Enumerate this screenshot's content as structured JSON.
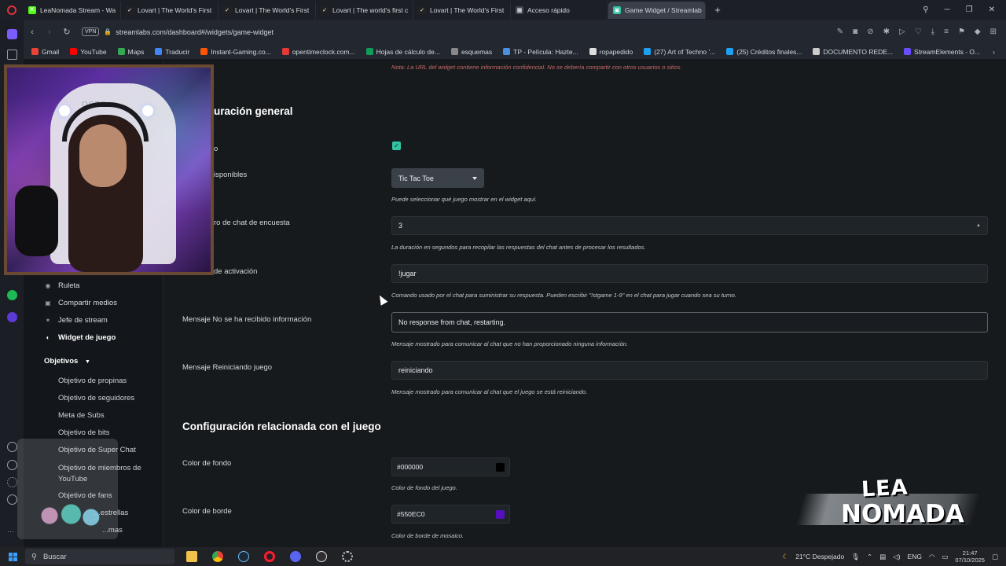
{
  "browser": {
    "tabs": [
      {
        "label": "LeaNomada Stream - Wa",
        "color": "#53fc18",
        "glyph": "K"
      },
      {
        "label": "Lovart | The World's First",
        "color": "#222222",
        "glyph": "✓"
      },
      {
        "label": "Lovart | The World's First",
        "color": "#222222",
        "glyph": "✓"
      },
      {
        "label": "Lovart | The world's first c",
        "color": "#222222",
        "glyph": "✓"
      },
      {
        "label": "Lovart | The World's First",
        "color": "#222222",
        "glyph": "✓"
      },
      {
        "label": "Acceso rápido",
        "color": "#444b55",
        "glyph": "▦"
      },
      {
        "label": "Game Widget / Streamlab",
        "color": "#31c3a2",
        "glyph": "▣"
      }
    ],
    "url": "streamlabs.com/dashboard#/widgets/game-widget",
    "vpn_label": "VPN",
    "bookmarks": [
      {
        "label": "Gmail",
        "color": "#ea4335"
      },
      {
        "label": "YouTube",
        "color": "#ff0000"
      },
      {
        "label": "Maps",
        "color": "#34a853"
      },
      {
        "label": "Traducir",
        "color": "#4285f4"
      },
      {
        "label": "Instant-Gaming.co...",
        "color": "#ff5400"
      },
      {
        "label": "opentimeclock.com...",
        "color": "#e53935"
      },
      {
        "label": "Hojas de cálculo de...",
        "color": "#0f9d58"
      },
      {
        "label": "esquemas",
        "color": "#888888"
      },
      {
        "label": "TP - Película: Hazte...",
        "color": "#4a90e2"
      },
      {
        "label": "ropapedido",
        "color": "#dddddd"
      },
      {
        "label": "(27) Art of Techno '...",
        "color": "#1da1f2"
      },
      {
        "label": "(25) Créditos finales...",
        "color": "#1da1f2"
      },
      {
        "label": "DOCUMENTO REDE...",
        "color": "#cccccc"
      },
      {
        "label": "StreamElements - O...",
        "color": "#6a4cff"
      }
    ]
  },
  "sidebar": {
    "items": [
      {
        "label": "Ruleta"
      },
      {
        "label": "Compartir medios"
      },
      {
        "label": "Jefe de stream"
      },
      {
        "label": "Widget de juego"
      }
    ],
    "goals_header": "Objetivos",
    "goals": [
      "Objetivo de propinas",
      "Objetivo de seguidores",
      "Meta de Subs",
      "Objetivo de bits",
      "Objetivo de Super Chat",
      "Objetivo de miembros de YouTube",
      "Objetivo de fans",
      "...estrellas",
      "...mas"
    ]
  },
  "main": {
    "note": "Nota: La URL del widget contiene información confidencial. No se debería compartir con otros usuarios o sitios.",
    "general_title": "uración general",
    "enabled_label": "o",
    "games_label": "isponibles",
    "game_select_value": "Tic Tac Toe",
    "game_help": "Puede seleccionar qué juego mostrar en el widget aquí.",
    "timer_label": "ro de chat de encuesta",
    "timer_value": "3",
    "timer_help": "La duración en segundos para recopilar las respuestas del chat antes de procesar los resultados.",
    "command_label": "de activación",
    "command_value": "!jugar",
    "command_help": "Comando usado por el chat para suministrar su respuesta. Pueden escribir \"!stgame 1-9\" en el chat para jugar cuando sea su turno.",
    "no_response_label": "Mensaje No se ha recibido información",
    "no_response_value": "No response from chat, restarting.",
    "no_response_help": "Mensaje mostrado para comunicar al chat que no han proporcionado ninguna información.",
    "restart_label": "Mensaje Reiniciando juego",
    "restart_value": "reiniciando",
    "restart_help": "Mensaje mostrado para comunicar al chat que el juego se está reiniciando.",
    "game_config_title": "Configuración relacionada con el juego",
    "bg_color_label": "Color de fondo",
    "bg_color_value": "#000000",
    "bg_color_help": "Color de fondo del juego.",
    "border_color_label": "Color de borde",
    "border_color_value": "#550EC0",
    "border_color_help": "Color de borde de mosaico."
  },
  "overlay": {
    "webcam_brand": "OSTO",
    "logo_line1": "LEA",
    "logo_line2": "NOMADA"
  },
  "taskbar": {
    "search_placeholder": "Buscar",
    "weather": "21°C Despejado",
    "language": "ENG",
    "time": "21:47",
    "date": "07/10/2025"
  }
}
